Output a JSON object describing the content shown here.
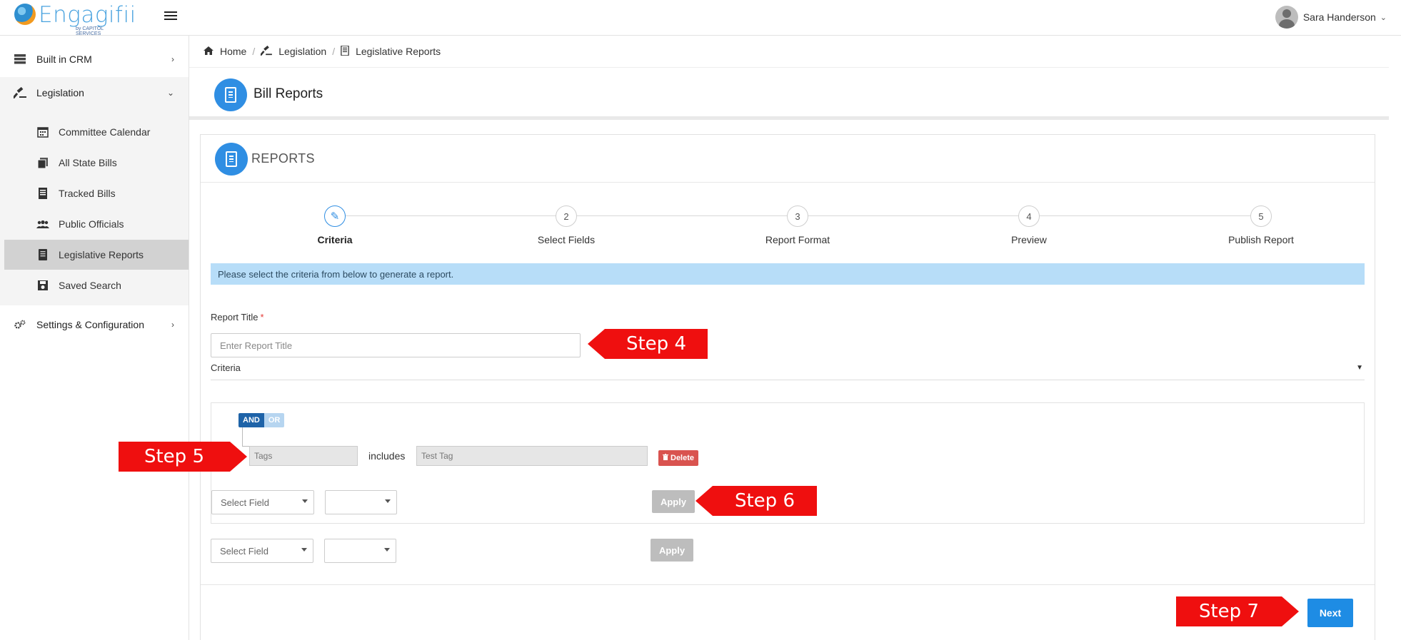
{
  "app": {
    "logo_text": "Engagifii",
    "logo_byline": "by CAPITOL SERVICES"
  },
  "user": {
    "name": "Sara Handerson"
  },
  "sidebar": {
    "items": [
      {
        "label": "Built in CRM",
        "icon": "server-icon"
      },
      {
        "label": "Legislation",
        "icon": "gavel-icon"
      },
      {
        "label": "Settings & Configuration",
        "icon": "cogs-icon"
      }
    ],
    "sub_items": [
      {
        "label": "Committee Calendar",
        "icon": "calendar-icon"
      },
      {
        "label": "All State Bills",
        "icon": "copy-icon"
      },
      {
        "label": "Tracked Bills",
        "icon": "document-icon"
      },
      {
        "label": "Public Officials",
        "icon": "users-icon"
      },
      {
        "label": "Legislative Reports",
        "icon": "report-icon",
        "active": true
      },
      {
        "label": "Saved Search",
        "icon": "save-icon"
      }
    ]
  },
  "breadcrumb": [
    "Home",
    "Legislation",
    "Legislative Reports"
  ],
  "page": {
    "title": "Bill Reports"
  },
  "card": {
    "title": "REPORTS"
  },
  "stepper": {
    "steps": [
      {
        "number": "✎",
        "label": "Criteria",
        "active": true
      },
      {
        "number": "2",
        "label": "Select Fields"
      },
      {
        "number": "3",
        "label": "Report Format"
      },
      {
        "number": "4",
        "label": "Preview"
      },
      {
        "number": "5",
        "label": "Publish Report"
      }
    ]
  },
  "info_message": "Please select the criteria from below to generate a report.",
  "form": {
    "report_title_label": "Report Title",
    "required_mark": "*",
    "report_title_placeholder": "Enter Report Title",
    "report_title_value": "",
    "criteria_label": "Criteria"
  },
  "builder": {
    "and_label": "AND",
    "or_label": "OR",
    "rule": {
      "field": "Tags",
      "operator": "includes",
      "value": "Test Tag"
    },
    "delete_label": "Delete",
    "select_field_placeholder": "Select Field",
    "apply_label": "Apply"
  },
  "next_label": "Next",
  "callouts": {
    "step4": "Step 4",
    "step5": "Step 5",
    "step6": "Step 6",
    "step7": "Step 7"
  },
  "colors": {
    "accent": "#2f8ee3",
    "info_bg": "#b7ddf8",
    "delete": "#d9534f",
    "next": "#1e8ce4",
    "callout": "#ef0f0f"
  }
}
